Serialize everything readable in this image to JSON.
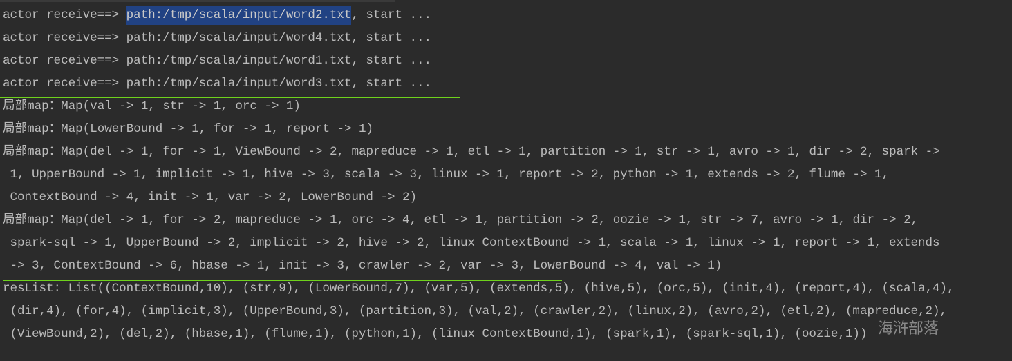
{
  "console": {
    "actor_lines": [
      {
        "prefix": "actor receive==> ",
        "path": "path:/tmp/scala/input/word2.txt",
        "suffix": ", start ...",
        "selected": true
      },
      {
        "prefix": "actor receive==> ",
        "path": "path:/tmp/scala/input/word4.txt",
        "suffix": ", start ...",
        "selected": false
      },
      {
        "prefix": "actor receive==> ",
        "path": "path:/tmp/scala/input/word1.txt",
        "suffix": ", start ...",
        "selected": false
      },
      {
        "prefix": "actor receive==> ",
        "path": "path:/tmp/scala/input/word3.txt",
        "suffix": ", start ...",
        "selected": false
      }
    ],
    "map_lines": [
      "局部map：Map(val -> 1, str -> 1, orc -> 1)",
      "局部map：Map(LowerBound -> 1, for -> 1, report -> 1)",
      "局部map：Map(del -> 1, for -> 1, ViewBound -> 2, mapreduce -> 1, etl -> 1, partition -> 1, str -> 1, avro -> 1, dir -> 2, spark ->",
      " 1, UpperBound -> 1, implicit -> 1, hive -> 3, scala -> 3, linux -> 1, report -> 2, python -> 1, extends -> 2, flume -> 1,",
      " ContextBound -> 4, init -> 1, var -> 2, LowerBound -> 2)",
      "局部map：Map(del -> 1, for -> 2, mapreduce -> 1, orc -> 4, etl -> 1, partition -> 2, oozie -> 1, str -> 7, avro -> 1, dir -> 2,",
      " spark-sql -> 1, UpperBound -> 2, implicit -> 2, hive -> 2, linux ContextBound -> 1, scala -> 1, linux -> 1, report -> 1, extends",
      " -> 3, ContextBound -> 6, hbase -> 1, init -> 3, crawler -> 2, var -> 3, LowerBound -> 4, val -> 1)"
    ],
    "result_lines": [
      "resList: List((ContextBound,10), (str,9), (LowerBound,7), (var,5), (extends,5), (hive,5), (orc,5), (init,4), (report,4), (scala,4),",
      " (dir,4), (for,4), (implicit,3), (UpperBound,3), (partition,3), (val,2), (crawler,2), (linux,2), (avro,2), (etl,2), (mapreduce,2),",
      " (ViewBound,2), (del,2), (hbase,1), (flume,1), (python,1), (linux ContextBound,1), (spark,1), (spark-sql,1), (oozie,1))"
    ],
    "watermark": "海浒部落"
  },
  "colors": {
    "background": "#2b2b2b",
    "text": "#bbbbbb",
    "selection": "#214283",
    "highlight_rule": "#6fd21c"
  }
}
